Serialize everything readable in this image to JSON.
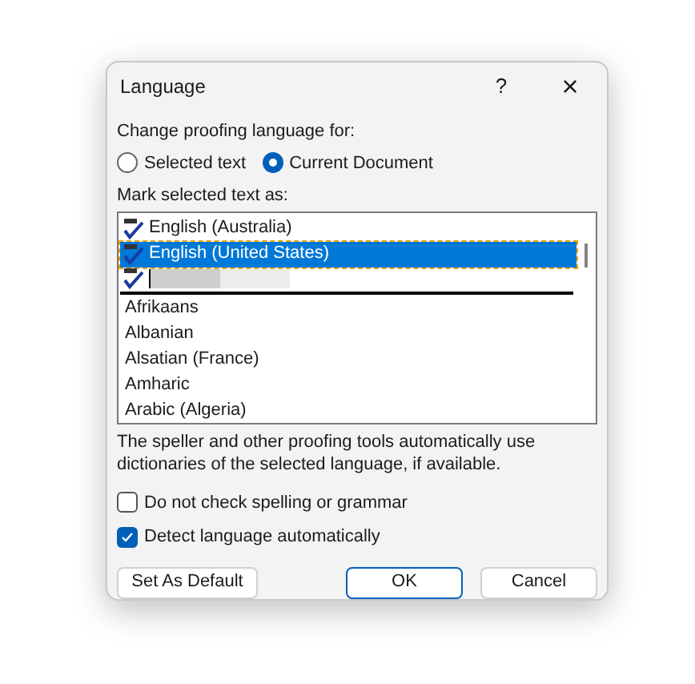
{
  "window": {
    "title": "Language"
  },
  "title_buttons": [
    "?",
    "×"
  ],
  "proofing_label": "Change proofing language for:",
  "radios": [
    {
      "label": "Selected text",
      "selected": false
    },
    {
      "label": "Current Document",
      "selected": true
    }
  ],
  "list_label": "Mark selected text as:",
  "recent_languages": [
    {
      "kind": "language",
      "label": "English (Australia)",
      "selected": false
    },
    {
      "kind": "language",
      "label": "English (United States)",
      "selected": true
    },
    {
      "kind": "redacted",
      "selected": false
    }
  ],
  "languages": [
    {
      "label": "Afrikaans",
      "selected": false
    },
    {
      "label": "Albanian",
      "selected": false
    },
    {
      "label": "Alsatian (France)",
      "selected": false
    },
    {
      "label": "Amharic",
      "selected": false
    },
    {
      "label": "Arabic (Algeria)",
      "selected": false
    }
  ],
  "description": "The speller and other proofing tools automatically use dictionaries of the selected language, if available.",
  "checkboxes": [
    {
      "label": "Do not check spelling or grammar",
      "checked": false
    },
    {
      "label": "Detect language automatically",
      "checked": true
    }
  ],
  "buttons": [
    {
      "label": "Set As Default",
      "kind": "secondary"
    },
    {
      "label": "OK",
      "kind": "primary"
    },
    {
      "label": "Cancel",
      "kind": "secondary"
    }
  ]
}
